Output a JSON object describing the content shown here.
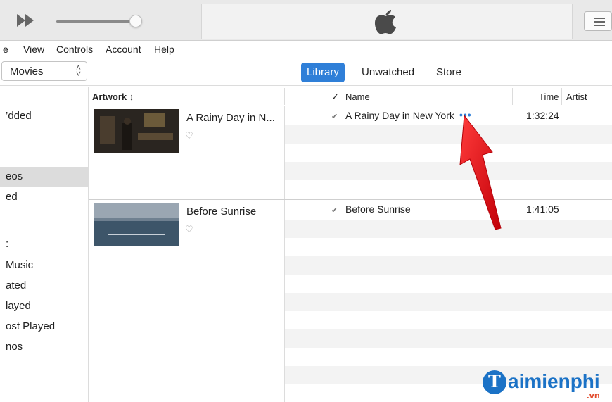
{
  "menu": {
    "items": [
      "e",
      "View",
      "Controls",
      "Account",
      "Help"
    ]
  },
  "media_select": {
    "value": "Movies"
  },
  "tabs": [
    {
      "label": "Library",
      "active": true
    },
    {
      "label": "Unwatched",
      "active": false
    },
    {
      "label": "Store",
      "active": false
    }
  ],
  "sidebar": {
    "items": [
      {
        "label": "’dded",
        "selected": false
      },
      {
        "label": "eos",
        "selected": true
      },
      {
        "label": "ed",
        "selected": false
      },
      {
        "label": ":",
        "selected": false
      },
      {
        "label": "Music",
        "selected": false
      },
      {
        "label": "ated",
        "selected": false
      },
      {
        "label": "layed",
        "selected": false
      },
      {
        "label": "ost Played",
        "selected": false
      },
      {
        "label": "nos",
        "selected": false
      }
    ]
  },
  "columns": {
    "artwork": "Artwork ↕",
    "check": "✓",
    "name": "Name",
    "time": "Time",
    "artist": "Artist"
  },
  "movies": [
    {
      "card_title": "A Rainy Day in N...",
      "name": "A Rainy Day in New York",
      "time": "1:32:24",
      "checked": true,
      "more": "•••"
    },
    {
      "card_title": "Before Sunrise",
      "name": "Before Sunrise",
      "time": "1:41:05",
      "checked": true
    }
  ],
  "icons": {
    "fast_forward": "fast-forward-icon",
    "apple": "apple-logo-icon",
    "list_view": "list-view-icon",
    "heart": "heart-icon",
    "arrow": "red-pointer-arrow"
  },
  "colors": {
    "accent": "#2f7fd8",
    "arrow": "#e8101a",
    "watermark": "#1b72c6"
  },
  "watermark": {
    "letter": "T",
    "text": "aimienphi",
    "suffix": ".vn"
  }
}
